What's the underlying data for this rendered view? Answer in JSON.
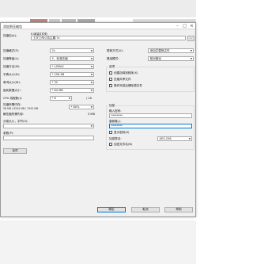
{
  "dialog": {
    "title": "添加到压缩包",
    "archive_label": "压缩包(A):",
    "archive_value": "E:\\新建文件夹\\",
    "archive_value2": "上次上传公告主题.7z",
    "browse_label": "...",
    "format_label": "压缩格式(F):",
    "format_value": "7z",
    "update_label": "更新方式(U):",
    "update_value": "添加并替换文件",
    "level_label": "压缩等级(L):",
    "level_value": "5 - 标准压缩",
    "path_label": "路径模式:",
    "path_value": "相对路径",
    "method_label": "压缩方法(M):",
    "method_value": "* LZMA2",
    "options_title": "选项",
    "opt1": "创建自释放程序(X)",
    "opt2": "压缩共享文件",
    "opt3": "操作完成后删除源文件",
    "dict_label": "字典大小(D):",
    "dict_value": "* 256 KB",
    "word_label": "单词大小(W):",
    "word_value": "* 32",
    "solid_label": "固实数据大小:",
    "solid_value": "* 64 MB",
    "cpu_label": "CPU 线程数(I):",
    "cpu_value": "* 8",
    "cpu_total": "/ 16",
    "mem_label": "压缩所需内存:",
    "mem_sub": "58 MB / 8294 MB / 7992 MB",
    "mem_pct": "* 80%",
    "decomp_label": "解压缩所需内存:",
    "decomp_value": "3 MB",
    "split_label": "分卷大小，字节(V):",
    "params_label": "参数(P):",
    "encrypt_title": "加密",
    "password_label": "输入密码:",
    "password_value": "********",
    "reenter_label": "重新输入:",
    "reenter_value": "********",
    "show_password": "显示密码(S)",
    "enc_method_label": "加密算法:",
    "enc_method_value": "AES-256",
    "enc_names": "加密文件名(N)",
    "options_button": "选项",
    "ok": "确定",
    "cancel": "取消",
    "help": "帮助"
  }
}
